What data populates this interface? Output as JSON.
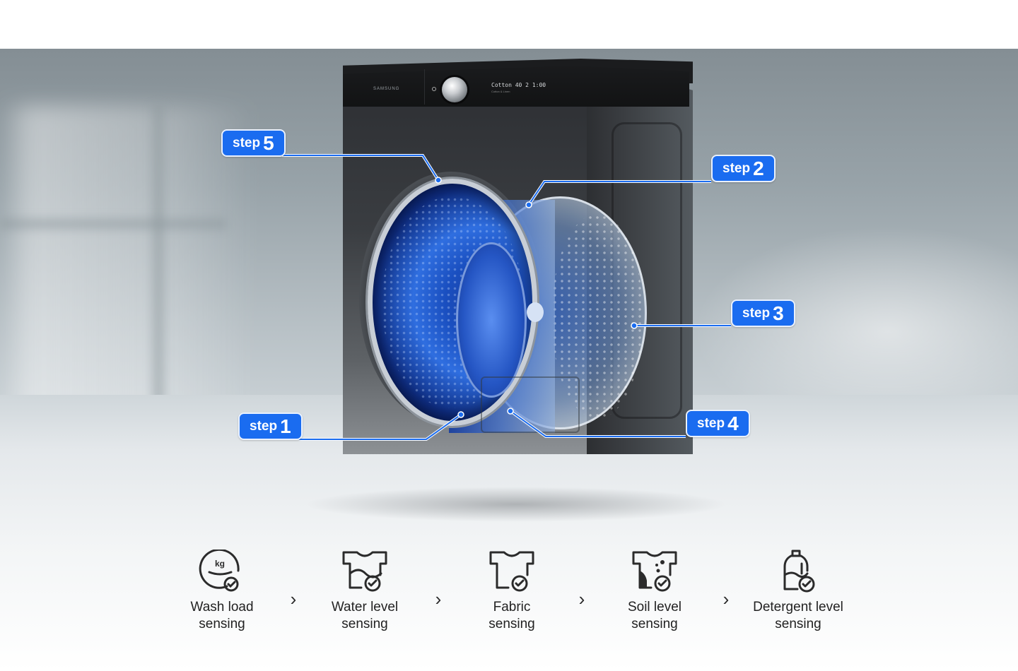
{
  "product": {
    "brand_label": "SAMSUNG",
    "display_program": "Cotton",
    "display_readout": "40  2  1:00",
    "display_sub": "Cotton & Linen"
  },
  "steps": [
    {
      "id": "step1",
      "word": "step",
      "number": "1"
    },
    {
      "id": "step2",
      "word": "step",
      "number": "2"
    },
    {
      "id": "step3",
      "word": "step",
      "number": "3"
    },
    {
      "id": "step4",
      "word": "step",
      "number": "4"
    },
    {
      "id": "step5",
      "word": "step",
      "number": "5"
    }
  ],
  "callout_color": "#1a6cf0",
  "process": [
    {
      "icon": "wash-load-kg-icon",
      "line1": "Wash load",
      "line2": "sensing"
    },
    {
      "icon": "water-level-shirt-icon",
      "line1": "Water level",
      "line2": "sensing"
    },
    {
      "icon": "fabric-shirt-icon",
      "line1": "Fabric",
      "line2": "sensing"
    },
    {
      "icon": "soil-level-shirt-icon",
      "line1": "Soil level",
      "line2": "sensing"
    },
    {
      "icon": "detergent-bottle-icon",
      "line1": "Detergent level",
      "line2": "sensing"
    }
  ],
  "arrow_glyph": "›"
}
